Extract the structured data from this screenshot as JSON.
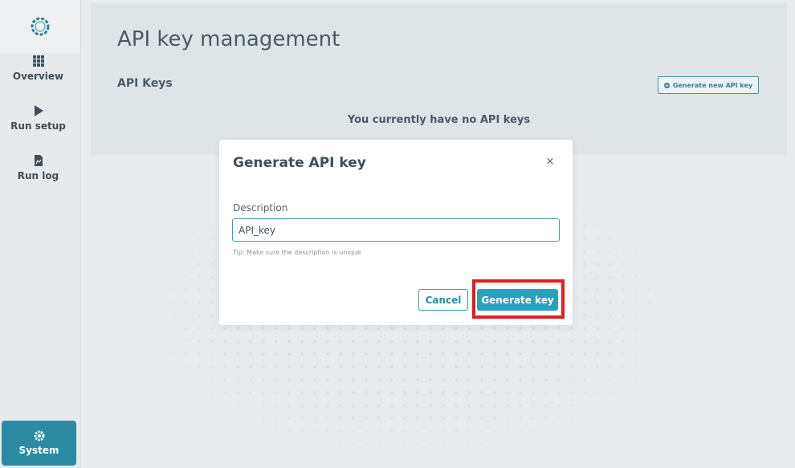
{
  "sidebar": {
    "logo_icon": "ring-logo-icon",
    "items": [
      {
        "label": "Overview",
        "icon": "grid-icon"
      },
      {
        "label": "Run setup",
        "icon": "play-icon"
      },
      {
        "label": "Run log",
        "icon": "document-icon"
      }
    ],
    "system": {
      "label": "System",
      "icon": "gear-icon",
      "active": true
    }
  },
  "header": {
    "title": "API key management",
    "section_title": "API Keys",
    "generate_new_label": "Generate new API key",
    "empty_message": "You currently have no API keys"
  },
  "modal": {
    "title": "Generate API key",
    "close_label": "×",
    "description_label": "Description",
    "description_value": "API_key",
    "tip": "Tip: Make sure the description is unique",
    "cancel_label": "Cancel",
    "generate_label": "Generate key"
  },
  "colors": {
    "accent": "#2aa0bf",
    "sidebar_active": "#2c8ba3",
    "highlight": "#e01e1e"
  }
}
